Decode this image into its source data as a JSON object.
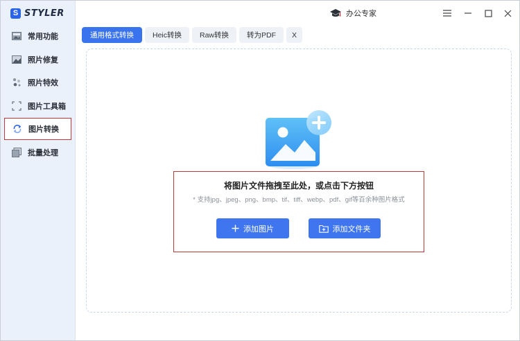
{
  "app": {
    "logo_mark": "S",
    "logo_text": "STYLER",
    "title": "办公专家"
  },
  "sidebar": {
    "items": [
      {
        "label": "常用功能",
        "icon": "common-icon"
      },
      {
        "label": "照片修复",
        "icon": "photo-repair-icon"
      },
      {
        "label": "照片特效",
        "icon": "effects-icon"
      },
      {
        "label": "图片工具箱",
        "icon": "toolbox-icon"
      },
      {
        "label": "图片转换",
        "icon": "convert-icon",
        "active": true
      },
      {
        "label": "批量处理",
        "icon": "batch-icon"
      }
    ]
  },
  "tabs": [
    {
      "label": "通用格式转换",
      "active": true
    },
    {
      "label": "Heic转换"
    },
    {
      "label": "Raw转换"
    },
    {
      "label": "转为PDF"
    },
    {
      "label": "X"
    }
  ],
  "drop": {
    "title": "将图片文件拖拽至此处，或点击下方按钮",
    "subtitle": "* 支持jpg、jpeg、png、bmp、tif、tiff、webp、pdf、gif等百余种图片格式",
    "add_image_label": "添加图片",
    "add_folder_label": "添加文件夹"
  },
  "colors": {
    "accent": "#3a73ee",
    "sidebar_bg": "#eaf1fb",
    "highlight": "#c9343a"
  }
}
